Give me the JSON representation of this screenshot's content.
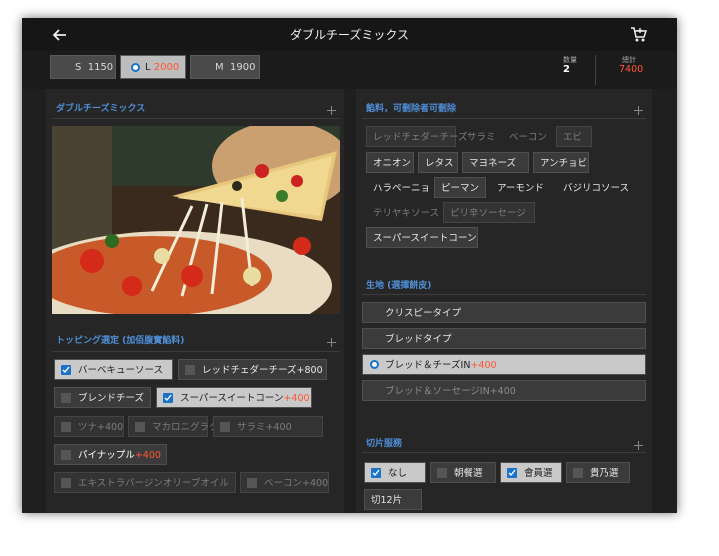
{
  "header": {
    "title": "ダブルチーズミックス"
  },
  "sizes": [
    {
      "letter": "S",
      "price": "1150",
      "selected": false
    },
    {
      "letter": "L",
      "price": "2000",
      "selected": true
    },
    {
      "letter": "M",
      "price": "1900",
      "selected": false
    }
  ],
  "summary": {
    "qty_label": "数量",
    "qty": "2",
    "total_label": "總計",
    "total": "7400"
  },
  "left": {
    "title": "ダブルチーズミックス",
    "topping_title": "トッピング選定 (加佰腹實餡料)",
    "toppings": [
      {
        "label": "バーベキューソース",
        "price": "",
        "checked": true
      },
      {
        "label": "レッドチェダーチーズ",
        "price": "+800",
        "checked": false
      },
      {
        "label": "ブレンドチーズ",
        "price": "",
        "checked": false
      },
      {
        "label": "スーパースイートコーン",
        "price": "+400",
        "checked": true
      },
      {
        "label": "ツナ",
        "price": "+400",
        "checked": false
      },
      {
        "label": "マカロニグラタン",
        "price": "",
        "checked": false
      },
      {
        "label": "サラミ",
        "price": "+400",
        "checked": false
      },
      {
        "label": "パイナップル",
        "price": "+400",
        "checked": false
      },
      {
        "label": "エキストラバージンオリーブオイル",
        "price": "",
        "checked": false
      },
      {
        "label": "ベーコン",
        "price": "+400",
        "checked": false
      }
    ]
  },
  "right": {
    "ingredients_title": "餡料，可刪除者可刪除",
    "ingredients": [
      {
        "label": "レッドチェダーチーズ",
        "active": false
      },
      {
        "label": "サラミ",
        "active": false
      },
      {
        "label": "ベーコン",
        "active": false
      },
      {
        "label": "エビ",
        "active": false
      },
      {
        "label": "オニオン",
        "active": true
      },
      {
        "label": "レタス",
        "active": true
      },
      {
        "label": "マヨネーズ",
        "active": true
      },
      {
        "label": "アンチョビ",
        "active": true
      },
      {
        "label": "ハラペーニョ",
        "active": true
      },
      {
        "label": "ピーマン",
        "active": true
      },
      {
        "label": "アーモンド",
        "active": true
      },
      {
        "label": "バジリコソース",
        "active": true
      },
      {
        "label": "テリヤキソース",
        "active": false
      },
      {
        "label": "ピリ辛ソーセージ",
        "active": false
      },
      {
        "label": "スーパースイートコーン",
        "active": true
      }
    ],
    "crust_title": "生地 (選擇餅皮)",
    "crusts": [
      {
        "label": "クリスピータイプ",
        "price": "",
        "selected": false
      },
      {
        "label": "ブレッドタイプ",
        "price": "",
        "selected": false
      },
      {
        "label": "ブレッド＆チーズIN",
        "price": "+400",
        "selected": true
      },
      {
        "label": "ブレッド＆ソーセージIN",
        "price": "+400",
        "selected": false
      }
    ],
    "cut_title": "切片服務",
    "cuts": [
      {
        "label": "なし",
        "checked": true
      },
      {
        "label": "朝餐選",
        "checked": false
      },
      {
        "label": "會員選",
        "checked": true
      },
      {
        "label": "貴乃選",
        "checked": false
      },
      {
        "label": "切12片",
        "checked": false
      }
    ]
  },
  "colors": {
    "accent": "#4f8fd8",
    "price": "#ff5533",
    "check": "#1a73c8"
  }
}
